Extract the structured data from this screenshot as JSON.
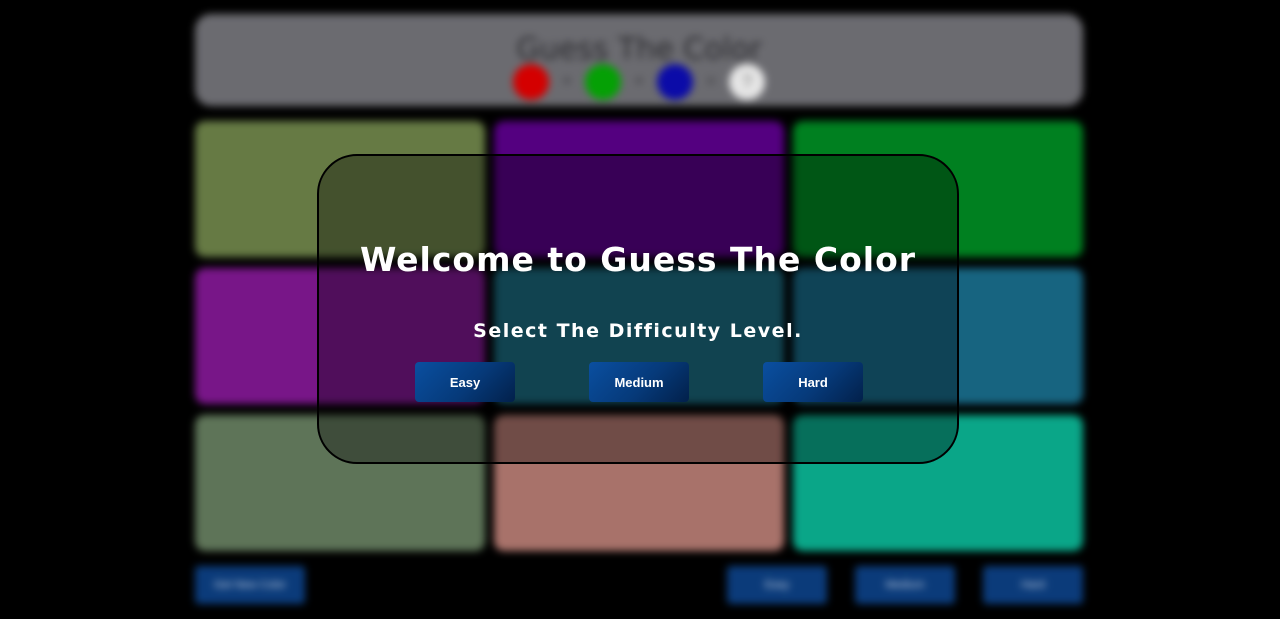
{
  "game": {
    "title": "Guess The Color",
    "formula": {
      "plus": "+",
      "equals": "=",
      "unknown": "?"
    },
    "tile_colors": [
      "#667a44",
      "#540080",
      "#008020",
      "#781688",
      "#1a6478",
      "#176480",
      "#5e7458",
      "#a8726a",
      "#0aa688"
    ],
    "bottom_buttons": {
      "new_colors": "Get New Color",
      "easy": "Easy",
      "medium": "Medium",
      "hard": "Hard"
    }
  },
  "modal": {
    "heading": "Welcome to Guess The Color",
    "subheading": "Select The Difficulty Level.",
    "buttons": {
      "easy": "Easy",
      "medium": "Medium",
      "hard": "Hard"
    },
    "accent_color": "#063a7a"
  }
}
